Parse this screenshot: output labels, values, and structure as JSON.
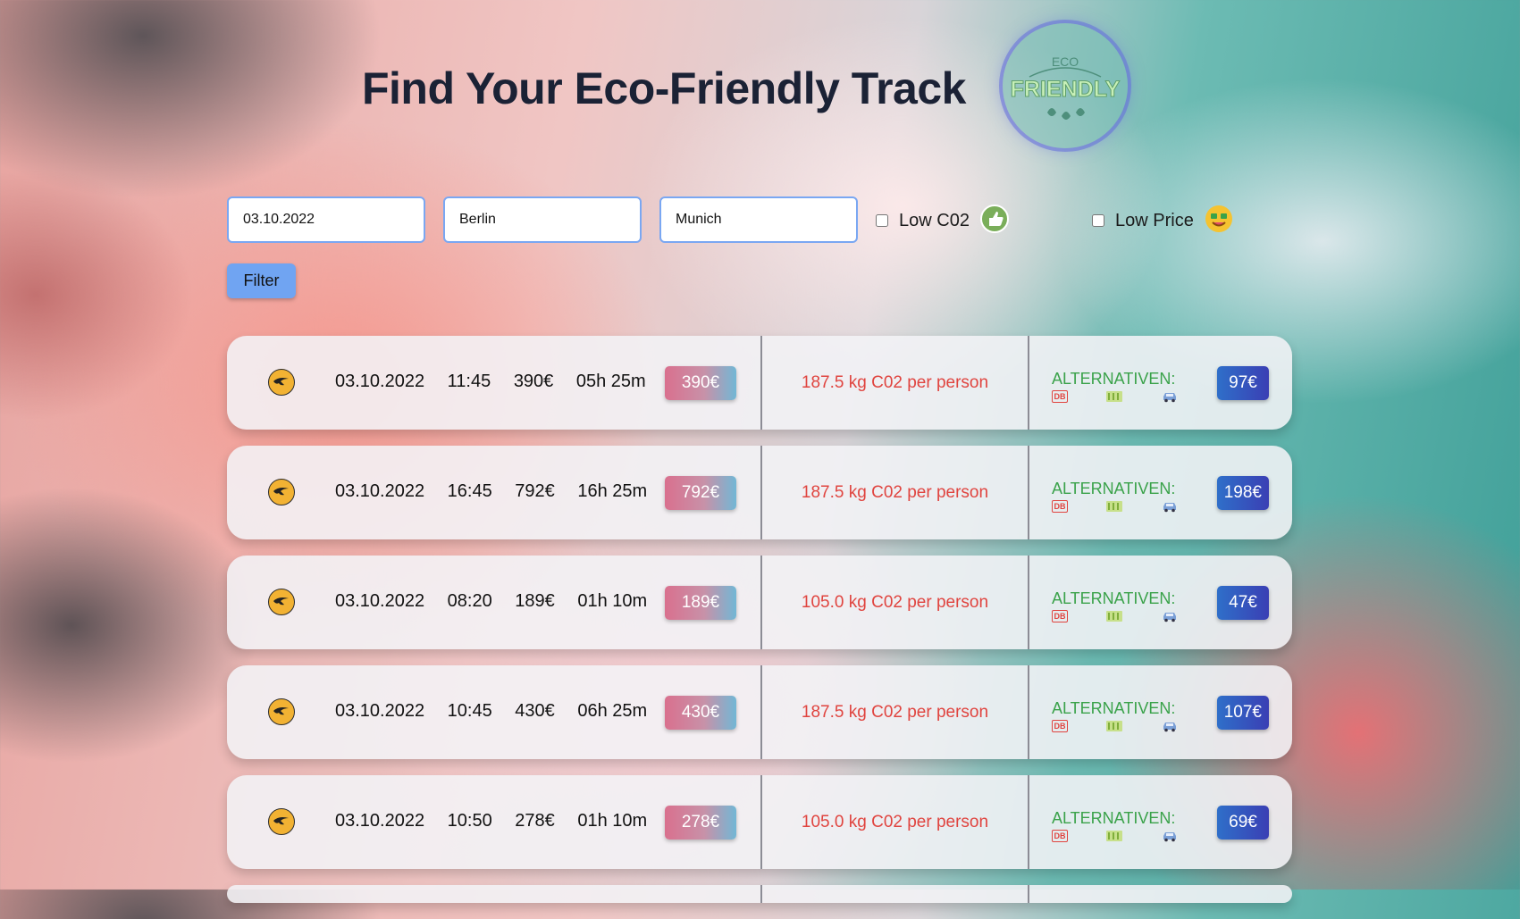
{
  "header": {
    "title": "Find Your Eco-Friendly Track",
    "logo": {
      "top_text": "ECO",
      "main_text": "FRIENDLY",
      "icon": "eco-friendly-logo"
    }
  },
  "search": {
    "date_value": "03.10.2022",
    "from_value": "Berlin",
    "to_value": "Munich",
    "low_co2": {
      "label": "Low C02",
      "checked": false,
      "icon": "thumbs-up-icon"
    },
    "low_price": {
      "label": "Low Price",
      "checked": false,
      "icon": "money-face-icon"
    },
    "filter_label": "Filter"
  },
  "results": {
    "airline_icon": "lufthansa-crane-icon",
    "alternatives_label": "ALTERNATIVEN:",
    "alternative_icons": [
      "db-train-icon",
      "bus-icon",
      "car-icon"
    ],
    "rows": [
      {
        "date": "03.10.2022",
        "time": "11:45",
        "price": "390€",
        "duration": "05h 25m",
        "badge": "390€",
        "co2": "187.5 kg C02 per person",
        "alt_price": "97€"
      },
      {
        "date": "03.10.2022",
        "time": "16:45",
        "price": "792€",
        "duration": "16h 25m",
        "badge": "792€",
        "co2": "187.5 kg C02 per person",
        "alt_price": "198€"
      },
      {
        "date": "03.10.2022",
        "time": "08:20",
        "price": "189€",
        "duration": "01h 10m",
        "badge": "189€",
        "co2": "105.0 kg C02 per person",
        "alt_price": "47€"
      },
      {
        "date": "03.10.2022",
        "time": "10:45",
        "price": "430€",
        "duration": "06h 25m",
        "badge": "430€",
        "co2": "187.5 kg C02 per person",
        "alt_price": "107€"
      },
      {
        "date": "03.10.2022",
        "time": "10:50",
        "price": "278€",
        "duration": "01h 10m",
        "badge": "278€",
        "co2": "105.0 kg C02 per person",
        "alt_price": "69€"
      }
    ]
  },
  "colors": {
    "title": "#1b2235",
    "co2_text": "#e0443f",
    "alternatives_text": "#3aa24a",
    "filter_button": "#70a4f2",
    "alt_price_badge": "#2f6fc9"
  }
}
